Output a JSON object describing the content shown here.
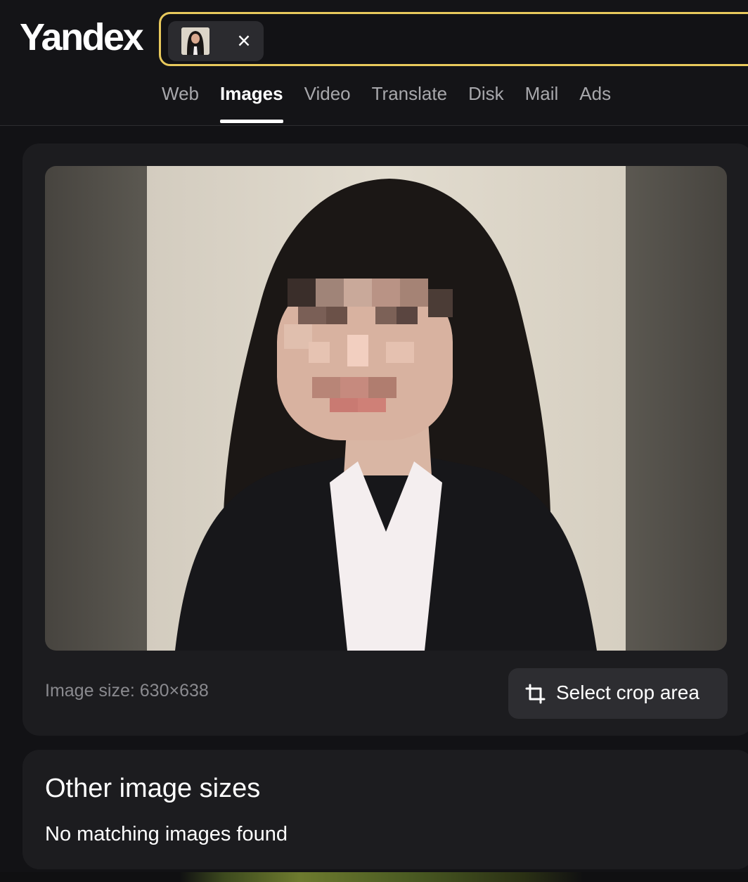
{
  "brand": {
    "logo_text": "Yandex"
  },
  "search": {
    "chip_thumb_alt": "uploaded-image-thumbnail",
    "chip_close_label": "×"
  },
  "tabs": [
    {
      "label": "Web",
      "active": false
    },
    {
      "label": "Images",
      "active": true
    },
    {
      "label": "Video",
      "active": false
    },
    {
      "label": "Translate",
      "active": false
    },
    {
      "label": "Disk",
      "active": false
    },
    {
      "label": "Mail",
      "active": false
    },
    {
      "label": "Ads",
      "active": false
    }
  ],
  "image_card": {
    "size_text": "Image size: 630×638",
    "crop_button_label": "Select crop area",
    "crop_icon": "crop-icon"
  },
  "other_sizes": {
    "title": "Other image sizes",
    "empty_message": "No matching images found"
  },
  "colors": {
    "search_border": "#e8c95c",
    "background": "#121215",
    "card": "#1c1c1f"
  }
}
